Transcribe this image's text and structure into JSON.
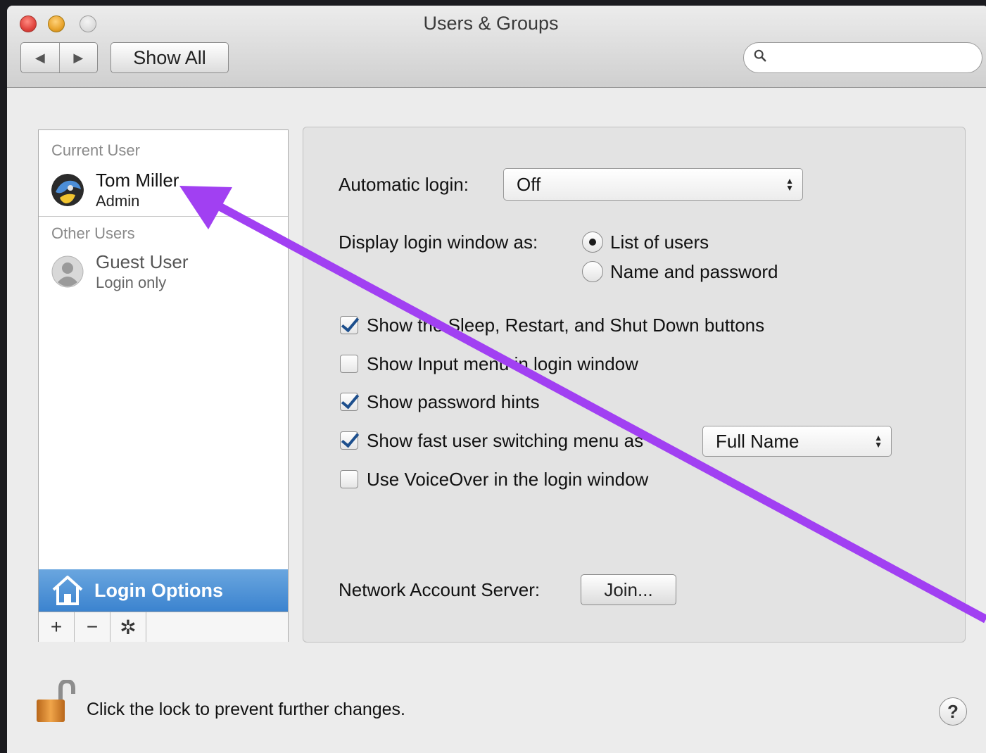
{
  "window": {
    "title": "Users & Groups"
  },
  "toolbar": {
    "back_icon": "◀",
    "forward_icon": "▶",
    "show_all_label": "Show All",
    "search_value": "",
    "search_placeholder": ""
  },
  "sidebar": {
    "current_user_header": "Current User",
    "current_user": {
      "name": "Tom Miller",
      "role": "Admin",
      "icon": "user-avatar"
    },
    "other_users_header": "Other Users",
    "other_users": [
      {
        "name": "Guest User",
        "role": "Login only",
        "icon": "guest-avatar"
      }
    ],
    "login_options_label": "Login Options",
    "add_label": "+",
    "remove_label": "−",
    "gear_label": "✲"
  },
  "login_options": {
    "automatic_login_label": "Automatic login:",
    "automatic_login_value": "Off",
    "display_as_label": "Display login window as:",
    "display_as_options": [
      {
        "label": "List of users",
        "selected": true
      },
      {
        "label": "Name and password",
        "selected": false
      }
    ],
    "checkboxes": [
      {
        "label": "Show the Sleep, Restart, and Shut Down buttons",
        "checked": true
      },
      {
        "label": "Show Input menu in login window",
        "checked": false
      },
      {
        "label": "Show password hints",
        "checked": true
      },
      {
        "label": "Show fast user switching menu as",
        "checked": true
      },
      {
        "label": "Use VoiceOver in the login window",
        "checked": false
      }
    ],
    "fast_switch_value": "Full Name",
    "network_server_label": "Network Account Server:",
    "join_label": "Join..."
  },
  "footer": {
    "lock_text": "Click the lock to prevent further changes.",
    "help_label": "?"
  },
  "colors": {
    "accent": "#3b83cf",
    "annotation_arrow": "#a140f2"
  }
}
